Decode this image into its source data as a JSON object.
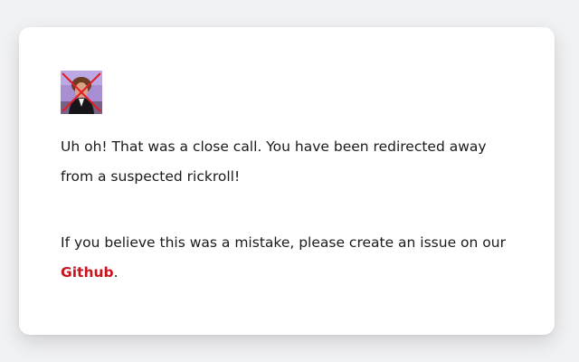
{
  "card": {
    "image_label": "blocked rickroll image",
    "message_primary": "Uh oh! That was a close call. You have been redirected away from a suspected rickroll!",
    "message_secondary_before": "If you believe this was a mistake, please create an issue on our ",
    "link_label": "Github",
    "message_secondary_after": "."
  },
  "colors": {
    "page_background": "#f1f2f4",
    "card_background": "#ffffff",
    "text": "#1a1a1a",
    "link": "#c8141e",
    "cross": "#e31d24"
  }
}
